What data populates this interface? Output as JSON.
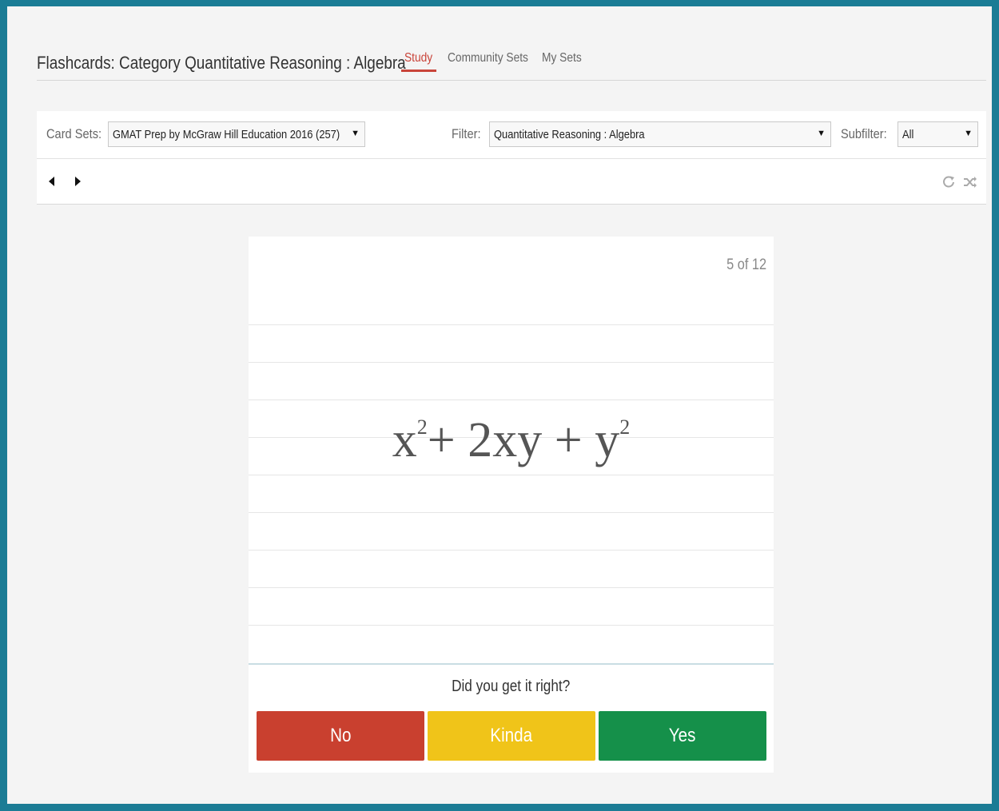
{
  "header": {
    "title": "Flashcards: Category Quantitative Reasoning : Algebra",
    "tabs": [
      {
        "label": "Study",
        "active": true
      },
      {
        "label": "Community Sets",
        "active": false
      },
      {
        "label": "My Sets",
        "active": false
      }
    ]
  },
  "toolbar": {
    "card_sets_label": "Card Sets:",
    "card_sets_value": "GMAT Prep by McGraw Hill Education 2016 (257)",
    "filter_label": "Filter:",
    "filter_value": "Quantitative Reasoning : Algebra",
    "subfilter_label": "Subfilter:",
    "subfilter_value": "All"
  },
  "nav": {
    "prev_icon": "caret-left-icon",
    "next_icon": "caret-right-icon",
    "reset_icon": "refresh-icon",
    "shuffle_icon": "shuffle-icon"
  },
  "card": {
    "counter": "5 of 12",
    "expression": {
      "part1": "x",
      "exp1": "2",
      "part2": "+ 2xy + y",
      "exp2": "2"
    }
  },
  "rating": {
    "question": "Did you get it right?",
    "buttons": [
      {
        "label": "No",
        "color": "#c9402f"
      },
      {
        "label": "Kinda",
        "color": "#f0c419"
      },
      {
        "label": "Yes",
        "color": "#15904a"
      }
    ]
  },
  "colors": {
    "frame": "#1b7c95",
    "active_tab": "#c9443a",
    "background": "#f4f4f4"
  }
}
